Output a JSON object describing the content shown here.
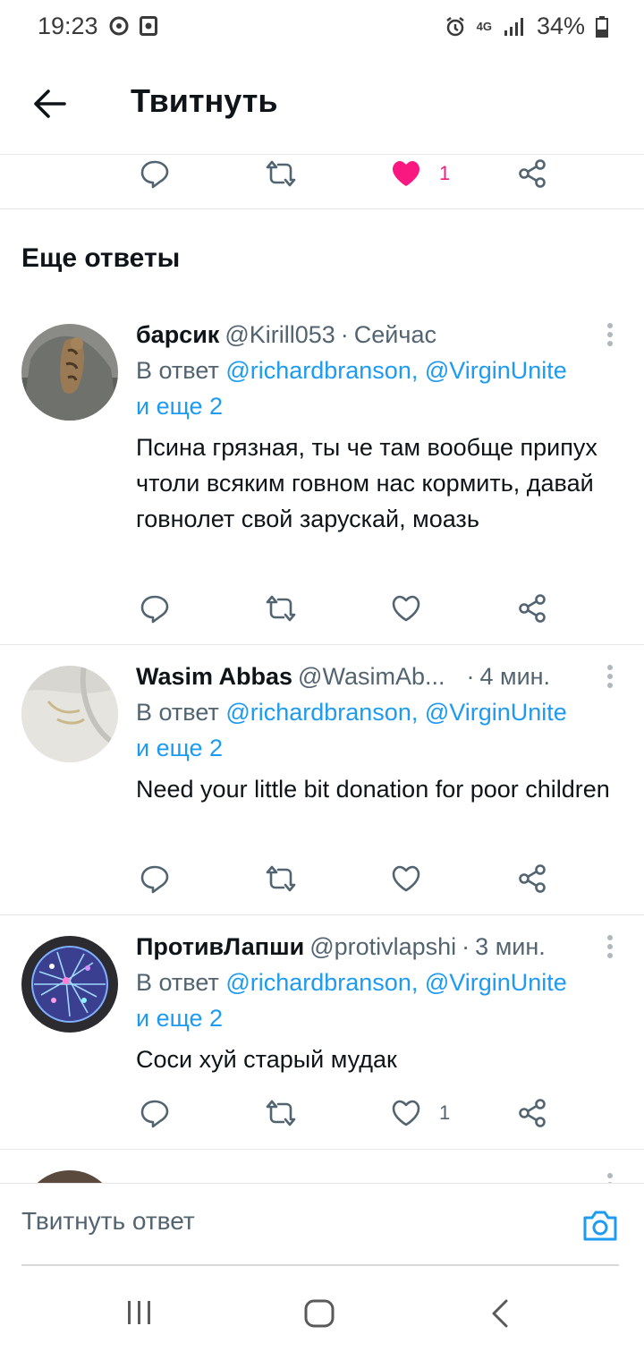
{
  "status_bar": {
    "time": "19:23",
    "battery": "34%",
    "network": "4G",
    "icons": [
      "mask-icon",
      "photo-icon",
      "alarm-icon",
      "signal-icon",
      "battery-icon"
    ]
  },
  "header": {
    "title": "Твитнуть",
    "back_icon": "back-arrow-icon"
  },
  "top_actions": {
    "like_count": "1"
  },
  "section_title": "Еще ответы",
  "replies": [
    {
      "name": "барсик",
      "handle": "@Kirill053",
      "time": "Сейчас",
      "reply_prefix": "В ответ ",
      "reply_mentions": "@richardbranson, @VirginUnite",
      "reply_more": "и еще 2",
      "text": "Псина грязная, ты че там вообще припух чтоли всяким говном нас кормить, давай говнолет свой зарускай, моазь",
      "like_count": ""
    },
    {
      "name": "Wasim Abbas",
      "handle": "@WasimAb...",
      "time": "4 мин.",
      "reply_prefix": "В ответ ",
      "reply_mentions": "@richardbranson, @VirginUnite",
      "reply_more": "и еще 2",
      "text": "Need your little bit donation for poor children",
      "like_count": ""
    },
    {
      "name": "ПротивЛапши",
      "handle": "@protivlapshi",
      "time": "3 мин.",
      "reply_prefix": "В ответ ",
      "reply_mentions": "@richardbranson, @VirginUnite",
      "reply_more": "и еще 2",
      "text": "Соси хуй старый мудак",
      "like_count": "1"
    }
  ],
  "compose": {
    "placeholder": "Твитнуть ответ",
    "camera_icon": "camera-icon"
  },
  "colors": {
    "accent": "#1d9bf0",
    "like": "#f91880",
    "muted": "#536471"
  }
}
